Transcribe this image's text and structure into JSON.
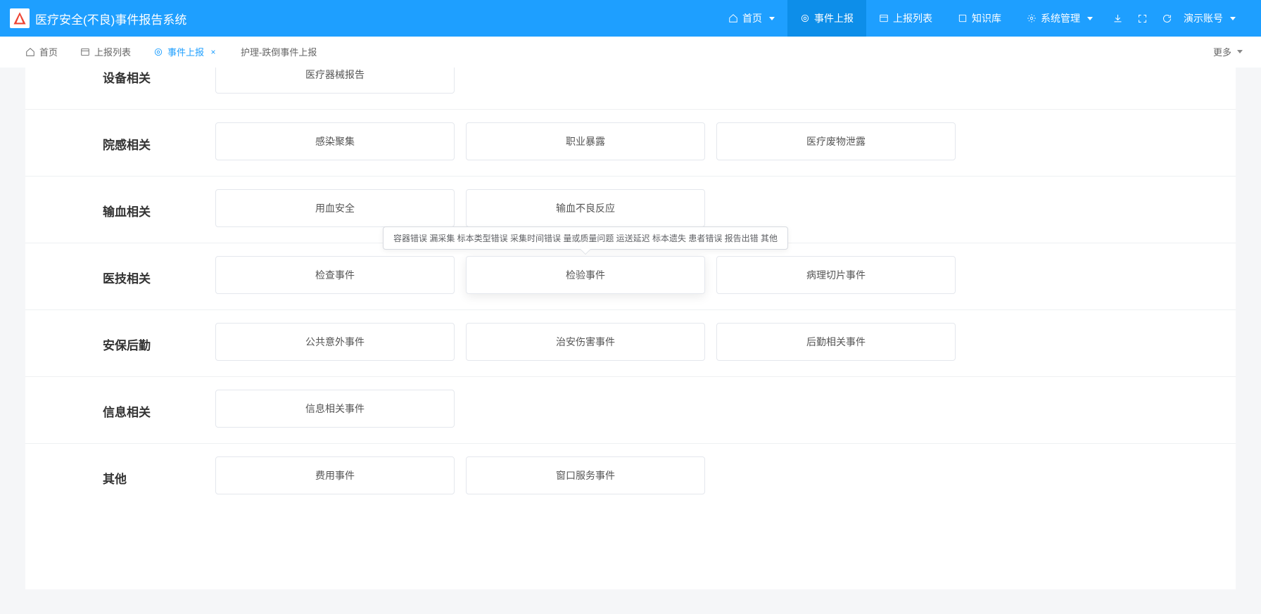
{
  "app": {
    "title": "医疗安全(不良)事件报告系统"
  },
  "topnav": {
    "home": "首页",
    "report": "事件上报",
    "report_list": "上报列表",
    "kb": "知识库",
    "sysmgr": "系统管理",
    "account": "演示账号"
  },
  "tabs": {
    "home": "首页",
    "report_list": "上报列表",
    "report": "事件上报",
    "nursing_fall": "护理-跌倒事件上报",
    "more": "更多"
  },
  "sections": [
    {
      "label": "设备相关",
      "cards": [
        {
          "id": "med-device",
          "text": "医疗器械报告"
        }
      ]
    },
    {
      "label": "院感相关",
      "cards": [
        {
          "id": "infection-cluster",
          "text": "感染聚集"
        },
        {
          "id": "occupational-exposure",
          "text": "职业暴露"
        },
        {
          "id": "medical-waste-leak",
          "text": "医疗废物泄露"
        }
      ]
    },
    {
      "label": "输血相关",
      "cards": [
        {
          "id": "blood-use-safety",
          "text": "用血安全"
        },
        {
          "id": "transfusion-adverse",
          "text": "输血不良反应"
        }
      ]
    },
    {
      "label": "医技相关",
      "cards": [
        {
          "id": "exam-event",
          "text": "检查事件"
        },
        {
          "id": "lab-event",
          "text": "检验事件",
          "hovered": true,
          "tooltip": "容器错误 漏采集 标本类型错误 采集时间错误 量或质量问题 运送延迟 标本遗失 患者错误 报告出错 其他"
        },
        {
          "id": "pathology-slice",
          "text": "病理切片事件"
        }
      ]
    },
    {
      "label": "安保后勤",
      "cards": [
        {
          "id": "public-accident",
          "text": "公共意外事件"
        },
        {
          "id": "security-injury",
          "text": "治安伤害事件"
        },
        {
          "id": "logistics-event",
          "text": "后勤相关事件"
        }
      ]
    },
    {
      "label": "信息相关",
      "cards": [
        {
          "id": "info-event",
          "text": "信息相关事件"
        }
      ]
    },
    {
      "label": "其他",
      "cards": [
        {
          "id": "fee-event",
          "text": "费用事件"
        },
        {
          "id": "counter-service",
          "text": "窗口服务事件"
        }
      ]
    }
  ]
}
